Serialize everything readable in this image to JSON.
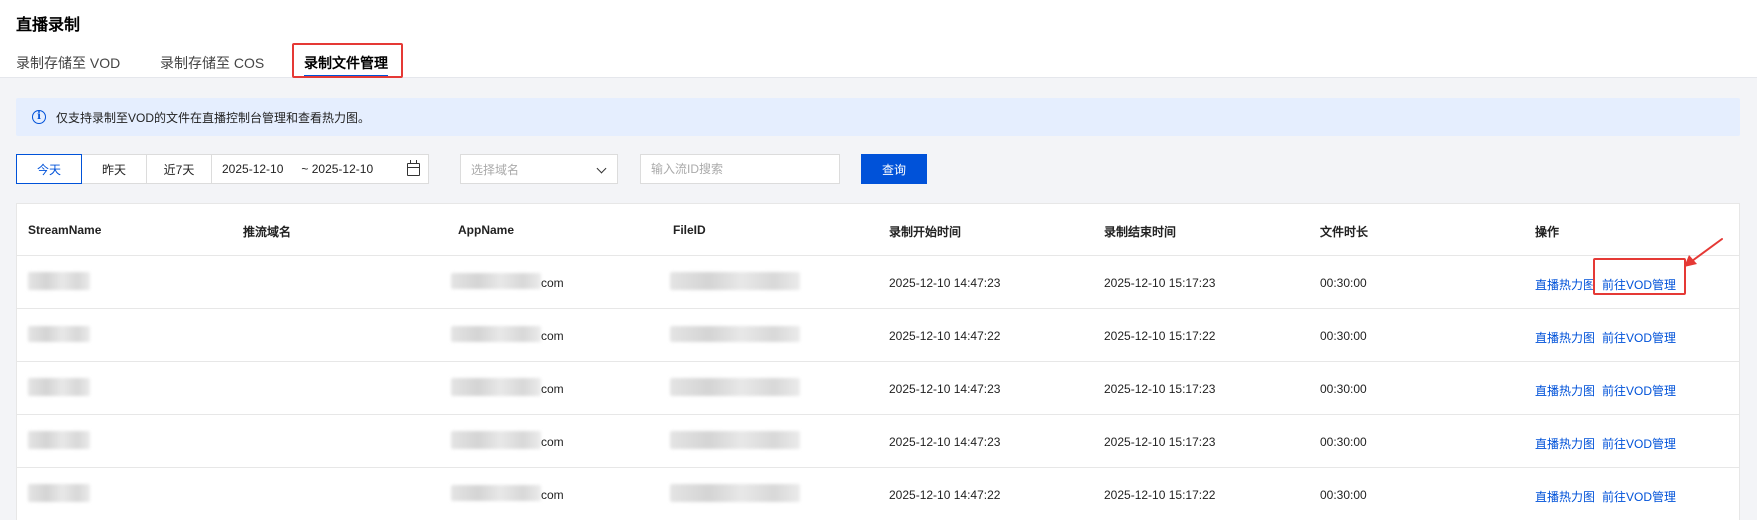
{
  "page": {
    "title": "直播录制",
    "tabs": [
      {
        "label": "录制存储至 VOD",
        "active": false
      },
      {
        "label": "录制存储至 COS",
        "active": false
      },
      {
        "label": "录制文件管理",
        "active": true
      }
    ]
  },
  "notice": {
    "text": "仅支持录制至VOD的文件在直播控制台管理和查看热力图。"
  },
  "filters": {
    "quick_dates": [
      "今天",
      "昨天",
      "近7天"
    ],
    "active_quick_date": "今天",
    "start_date": "2025-12-10",
    "end_date": "~ 2025-12-10",
    "domain_select_placeholder": "选择域名",
    "stream_search_placeholder": "输入流ID搜索",
    "query_label": "查询"
  },
  "table": {
    "columns": [
      "StreamName",
      "推流域名",
      "AppName",
      "FileID",
      "录制开始时间",
      "录制结束时间",
      "文件时长",
      "操作"
    ],
    "rows": [
      {
        "app_suffix": "com",
        "start": "2025-12-10 14:47:23",
        "end": "2025-12-10 15:17:23",
        "duration": "00:30:00",
        "actions": [
          "直播热力图",
          "前往VOD管理"
        ]
      },
      {
        "app_suffix": "com",
        "start": "2025-12-10 14:47:22",
        "end": "2025-12-10 15:17:22",
        "duration": "00:30:00",
        "actions": [
          "直播热力图",
          "前往VOD管理"
        ]
      },
      {
        "app_suffix": "com",
        "start": "2025-12-10 14:47:23",
        "end": "2025-12-10 15:17:23",
        "duration": "00:30:00",
        "actions": [
          "直播热力图",
          "前往VOD管理"
        ]
      },
      {
        "app_suffix": "com",
        "start": "2025-12-10 14:47:23",
        "end": "2025-12-10 15:17:23",
        "duration": "00:30:00",
        "actions": [
          "直播热力图",
          "前往VOD管理"
        ]
      },
      {
        "app_suffix": "com",
        "start": "2025-12-10 14:47:22",
        "end": "2025-12-10 15:17:22",
        "duration": "00:30:00",
        "actions": [
          "直播热力图",
          "前往VOD管理"
        ]
      }
    ]
  },
  "colors": {
    "accent": "#0052d9",
    "annotation": "#e53935",
    "notice_bg": "#e5eefe"
  }
}
